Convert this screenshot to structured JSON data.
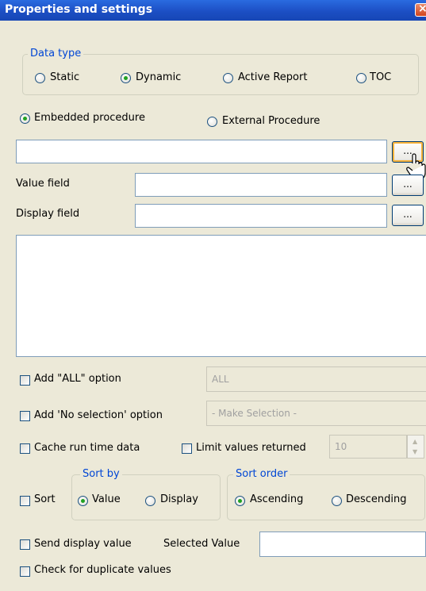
{
  "window": {
    "title": "Properties and settings"
  },
  "icons": {
    "close": "close-icon",
    "cursor": "cursor-icon"
  },
  "data_type": {
    "legend": "Data type",
    "options": [
      "Static",
      "Dynamic",
      "Active Report",
      "TOC"
    ],
    "selected": "Dynamic"
  },
  "procedure": {
    "options": [
      "Embedded procedure",
      "External Procedure"
    ],
    "selected": "Embedded procedure",
    "value": "",
    "browse_label": "..."
  },
  "value_field": {
    "label": "Value field",
    "value": "",
    "browse_label": "..."
  },
  "display_field": {
    "label": "Display field",
    "value": "",
    "browse_label": "..."
  },
  "options": {
    "add_all": {
      "label": "Add \"ALL\" option",
      "checked": false,
      "value": "ALL"
    },
    "add_no_selection": {
      "label": "Add 'No selection' option",
      "checked": false,
      "value": "- Make Selection -"
    },
    "cache": {
      "label": "Cache run time data",
      "checked": false
    },
    "limit": {
      "label": "Limit values returned",
      "checked": false,
      "value": "10"
    },
    "sort": {
      "label": "Sort",
      "checked": false
    },
    "send_display": {
      "label": "Send display value",
      "checked": false
    },
    "check_duplicates": {
      "label": "Check for duplicate values",
      "checked": false
    }
  },
  "sort_by": {
    "legend": "Sort by",
    "options": [
      "Value",
      "Display"
    ],
    "selected": "Value"
  },
  "sort_order": {
    "legend": "Sort order",
    "options": [
      "Ascending",
      "Descending"
    ],
    "selected": "Ascending"
  },
  "selected_value": {
    "label": "Selected Value",
    "value": ""
  },
  "colors": {
    "titlebar": "#1C4FC4",
    "dialog_bg": "#ECE9D8",
    "group_legend": "#0046D5",
    "radio_dot": "#21A121"
  }
}
